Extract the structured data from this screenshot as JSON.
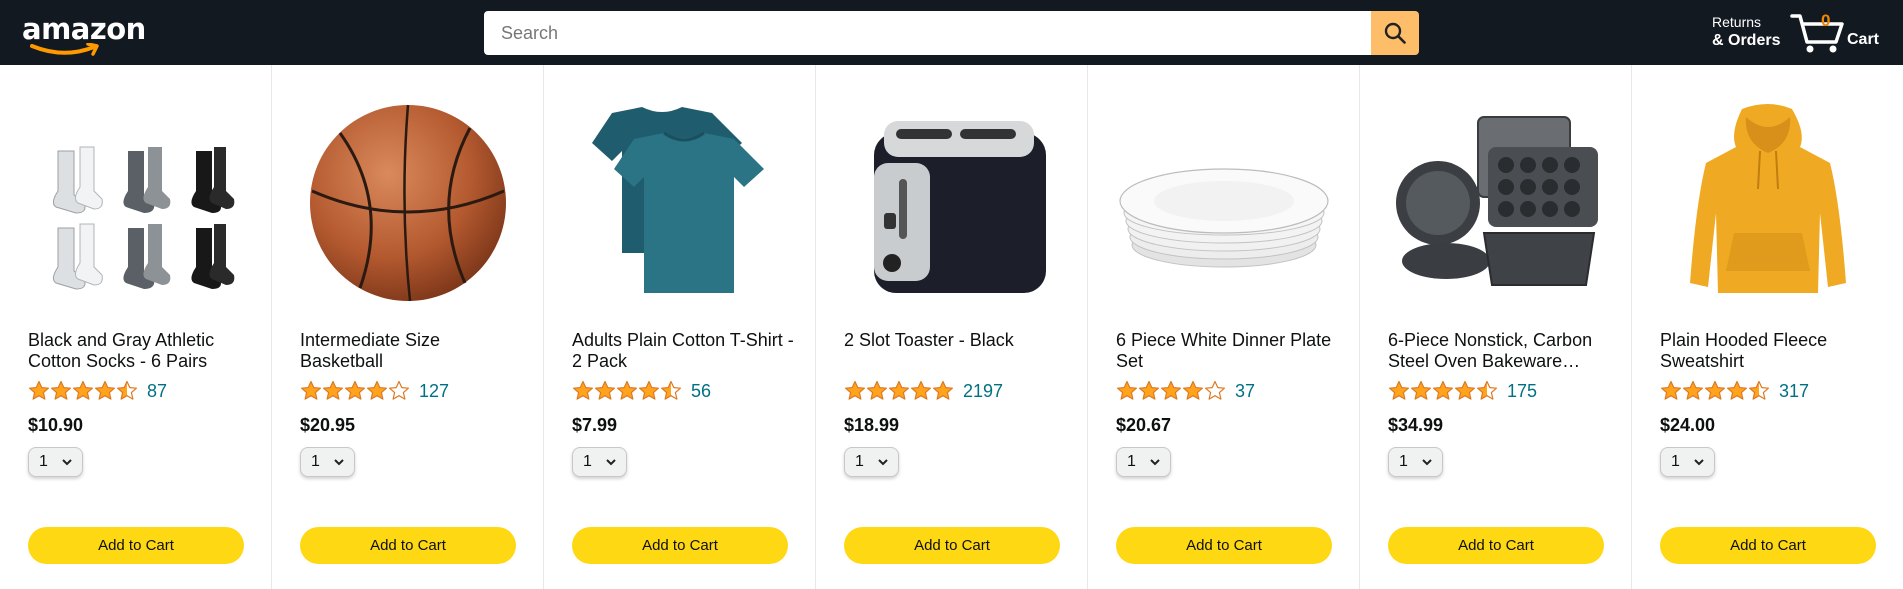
{
  "header": {
    "logo_text": "amazon",
    "search": {
      "placeholder": "Search",
      "value": ""
    },
    "orders_line1": "Returns",
    "orders_line2": "& Orders",
    "cart_count": "0",
    "cart_label": "Cart"
  },
  "colors": {
    "header_bg": "#131921",
    "search_button": "#febd69",
    "add_to_cart": "#ffd814",
    "star": "#ffa41c",
    "link": "#007185",
    "cart_count": "#f08804"
  },
  "products": [
    {
      "name": "Black and Gray Athletic Cotton Socks - 6 Pairs",
      "rating": 4.5,
      "rating_count": "87",
      "price": "$10.90",
      "quantity": "1",
      "add_label": "Add to Cart",
      "image_icon": "socks-image"
    },
    {
      "name": "Intermediate Size Basketball",
      "rating": 4.0,
      "rating_count": "127",
      "price": "$20.95",
      "quantity": "1",
      "add_label": "Add to Cart",
      "image_icon": "basketball-image"
    },
    {
      "name": "Adults Plain Cotton T-Shirt - 2 Pack",
      "rating": 4.5,
      "rating_count": "56",
      "price": "$7.99",
      "quantity": "1",
      "add_label": "Add to Cart",
      "image_icon": "tshirt-image"
    },
    {
      "name": "2 Slot Toaster - Black",
      "rating": 5.0,
      "rating_count": "2197",
      "price": "$18.99",
      "quantity": "1",
      "add_label": "Add to Cart",
      "image_icon": "toaster-image"
    },
    {
      "name": "6 Piece White Dinner Plate Set",
      "rating": 4.0,
      "rating_count": "37",
      "price": "$20.67",
      "quantity": "1",
      "add_label": "Add to Cart",
      "image_icon": "plates-image"
    },
    {
      "name": "6-Piece Nonstick, Carbon Steel Oven Bakeware…",
      "rating": 4.5,
      "rating_count": "175",
      "price": "$34.99",
      "quantity": "1",
      "add_label": "Add to Cart",
      "image_icon": "bakeware-image"
    },
    {
      "name": "Plain Hooded Fleece Sweatshirt",
      "rating": 4.5,
      "rating_count": "317",
      "price": "$24.00",
      "quantity": "1",
      "add_label": "Add to Cart",
      "image_icon": "hoodie-image"
    }
  ]
}
